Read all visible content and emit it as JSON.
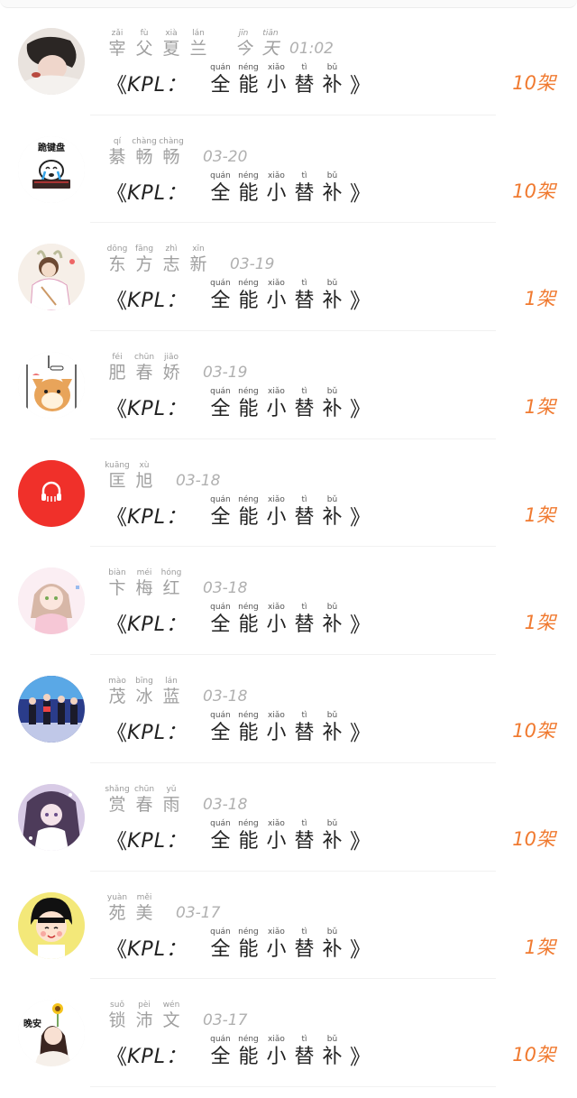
{
  "rows": [
    {
      "name": [
        {
          "py": "zǎi",
          "ch": "宰"
        },
        {
          "py": "fù",
          "ch": "父"
        },
        {
          "py": "xià",
          "ch": "夏"
        },
        {
          "py": "lán",
          "ch": "兰"
        }
      ],
      "time": "今天 01:02",
      "time_ruby": [
        {
          "py": "jīn",
          "ch": "今"
        },
        {
          "py": "tiān",
          "ch": "天"
        }
      ],
      "time_suffix": "01:02",
      "quantity": "10架",
      "avatar": "photo-girl-icon"
    },
    {
      "name": [
        {
          "py": "qí",
          "ch": "綦"
        },
        {
          "py": "chàng",
          "ch": "畅"
        },
        {
          "py": "chàng",
          "ch": "畅"
        }
      ],
      "time": "03-20",
      "quantity": "10架",
      "avatar": "crying-keyboard-icon",
      "avatar_caption": "跪键盘"
    },
    {
      "name": [
        {
          "py": "dōng",
          "ch": "东"
        },
        {
          "py": "fāng",
          "ch": "方"
        },
        {
          "py": "zhì",
          "ch": "志"
        },
        {
          "py": "xīn",
          "ch": "新"
        }
      ],
      "time": "03-19",
      "quantity": "1架",
      "avatar": "bunny-couple-icon"
    },
    {
      "name": [
        {
          "py": "féi",
          "ch": "肥"
        },
        {
          "py": "chūn",
          "ch": "春"
        },
        {
          "py": "jiāo",
          "ch": "娇"
        }
      ],
      "time": "03-19",
      "quantity": "1架",
      "avatar": "shiba-dog-icon"
    },
    {
      "name": [
        {
          "py": "kuāng",
          "ch": "匡"
        },
        {
          "py": "xù",
          "ch": "旭"
        }
      ],
      "time": "03-18",
      "quantity": "1架",
      "avatar": "red-headphones-icon"
    },
    {
      "name": [
        {
          "py": "biàn",
          "ch": "卞"
        },
        {
          "py": "méi",
          "ch": "梅"
        },
        {
          "py": "hóng",
          "ch": "红"
        }
      ],
      "time": "03-18",
      "quantity": "1架",
      "avatar": "anime-girl-icon"
    },
    {
      "name": [
        {
          "py": "mào",
          "ch": "茂"
        },
        {
          "py": "bīng",
          "ch": "冰"
        },
        {
          "py": "lán",
          "ch": "蓝"
        }
      ],
      "time": "03-18",
      "quantity": "10架",
      "avatar": "stage-group-icon"
    },
    {
      "name": [
        {
          "py": "shǎng",
          "ch": "赏"
        },
        {
          "py": "chūn",
          "ch": "春"
        },
        {
          "py": "yǔ",
          "ch": "雨"
        }
      ],
      "time": "03-18",
      "quantity": "10架",
      "avatar": "purple-anime-icon"
    },
    {
      "name": [
        {
          "py": "yuàn",
          "ch": "苑"
        },
        {
          "py": "měi",
          "ch": "美"
        }
      ],
      "time": "03-17",
      "quantity": "1架",
      "avatar": "maruko-icon"
    },
    {
      "name": [
        {
          "py": "suǒ",
          "ch": "锁"
        },
        {
          "py": "pèi",
          "ch": "沛"
        },
        {
          "py": "wén",
          "ch": "文"
        }
      ],
      "time": "03-17",
      "quantity": "10架",
      "avatar": "sunflower-girl-icon",
      "avatar_caption": "晚安"
    }
  ],
  "gift": {
    "open": "《",
    "prefix": "KPL：",
    "close": "》",
    "chars": [
      {
        "py": "quán",
        "ch": "全"
      },
      {
        "py": "néng",
        "ch": "能"
      },
      {
        "py": "xiǎo",
        "ch": "小"
      },
      {
        "py": "tì",
        "ch": "替"
      },
      {
        "py": "bǔ",
        "ch": "补"
      }
    ]
  },
  "colors": {
    "quantity": "#f07a30",
    "name": "#a0a0a0",
    "title": "#222222"
  }
}
